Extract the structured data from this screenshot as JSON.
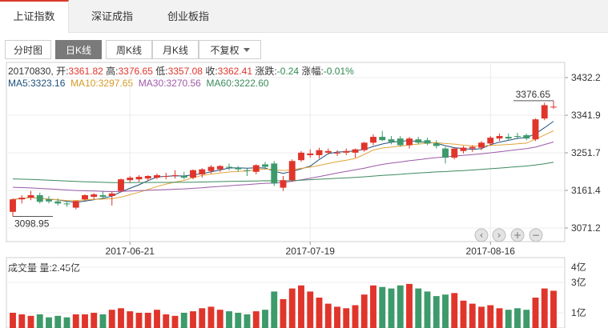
{
  "market_tabs": [
    {
      "label": "上证指数",
      "active": true
    },
    {
      "label": "深证成指",
      "active": false
    },
    {
      "label": "创业板指",
      "active": false
    }
  ],
  "kline_tabs": [
    {
      "label": "分时图",
      "active": false
    },
    {
      "label": "日K线",
      "active": true
    },
    {
      "label": "周K线",
      "active": false
    },
    {
      "label": "月K线",
      "active": false
    },
    {
      "label": "不复权",
      "active": false,
      "dropdown": true
    }
  ],
  "quote": {
    "date": "20170830",
    "open_label": "开:",
    "open": "3361.82",
    "high_label": "高:",
    "high": "3376.65",
    "low_label": "低:",
    "low": "3357.08",
    "close_label": "收:",
    "close": "3362.41",
    "change_label": "涨跌:",
    "change": "-0.24",
    "pct_label": "涨幅:",
    "pct": "-0.01%"
  },
  "ma": {
    "ma5": "MA5:3323.16",
    "ma10": "MA10:3297.65",
    "ma30": "MA30:3270.56",
    "ma60": "MA60:3222.60"
  },
  "volume": {
    "label": "成交量",
    "value_label": "量:2.45亿"
  },
  "colors": {
    "up": "#e0352b",
    "down": "#3d9a6a",
    "ma5": "#1d4f7c",
    "ma10": "#e0a43a",
    "ma30": "#9b5aa8",
    "ma60": "#3c8a5c"
  },
  "chart_data": {
    "type": "candlestick",
    "y_ticks": [
      "3432.2",
      "3341.9",
      "3251.7",
      "3161.4",
      "3071.2"
    ],
    "ylim": [
      3071.2,
      3432.2
    ],
    "x_ticks": [
      "2017-06-21",
      "2017-07-19",
      "2017-08-16"
    ],
    "annotations": {
      "max": "3376.65",
      "min": "3098.95"
    },
    "volume_ticks": [
      "4亿",
      "3亿",
      "1亿"
    ],
    "volume_ylim": [
      0,
      4
    ],
    "candles": [
      {
        "o": 3110,
        "h": 3142,
        "l": 3099,
        "c": 3140
      },
      {
        "o": 3140,
        "h": 3150,
        "l": 3130,
        "c": 3144
      },
      {
        "o": 3144,
        "h": 3160,
        "l": 3138,
        "c": 3150
      },
      {
        "o": 3150,
        "h": 3156,
        "l": 3130,
        "c": 3134
      },
      {
        "o": 3140,
        "h": 3148,
        "l": 3130,
        "c": 3135
      },
      {
        "o": 3135,
        "h": 3142,
        "l": 3125,
        "c": 3130
      },
      {
        "o": 3130,
        "h": 3136,
        "l": 3122,
        "c": 3128
      },
      {
        "o": 3120,
        "h": 3137,
        "l": 3116,
        "c": 3136
      },
      {
        "o": 3140,
        "h": 3152,
        "l": 3136,
        "c": 3150
      },
      {
        "o": 3146,
        "h": 3155,
        "l": 3140,
        "c": 3152
      },
      {
        "o": 3150,
        "h": 3160,
        "l": 3142,
        "c": 3146
      },
      {
        "o": 3148,
        "h": 3158,
        "l": 3125,
        "c": 3154
      },
      {
        "o": 3160,
        "h": 3190,
        "l": 3158,
        "c": 3188
      },
      {
        "o": 3186,
        "h": 3196,
        "l": 3180,
        "c": 3192
      },
      {
        "o": 3188,
        "h": 3198,
        "l": 3182,
        "c": 3194
      },
      {
        "o": 3190,
        "h": 3198,
        "l": 3184,
        "c": 3196
      },
      {
        "o": 3192,
        "h": 3202,
        "l": 3188,
        "c": 3198
      },
      {
        "o": 3194,
        "h": 3204,
        "l": 3188,
        "c": 3196
      },
      {
        "o": 3196,
        "h": 3210,
        "l": 3190,
        "c": 3198
      },
      {
        "o": 3196,
        "h": 3206,
        "l": 3188,
        "c": 3192
      },
      {
        "o": 3192,
        "h": 3212,
        "l": 3188,
        "c": 3210
      },
      {
        "o": 3200,
        "h": 3215,
        "l": 3192,
        "c": 3212
      },
      {
        "o": 3208,
        "h": 3222,
        "l": 3202,
        "c": 3218
      },
      {
        "o": 3212,
        "h": 3222,
        "l": 3206,
        "c": 3220
      },
      {
        "o": 3218,
        "h": 3226,
        "l": 3210,
        "c": 3216
      },
      {
        "o": 3216,
        "h": 3220,
        "l": 3206,
        "c": 3212
      },
      {
        "o": 3210,
        "h": 3214,
        "l": 3196,
        "c": 3208
      },
      {
        "o": 3206,
        "h": 3224,
        "l": 3200,
        "c": 3222
      },
      {
        "o": 3224,
        "h": 3230,
        "l": 3212,
        "c": 3218
      },
      {
        "o": 3226,
        "h": 3232,
        "l": 3172,
        "c": 3178
      },
      {
        "o": 3168,
        "h": 3196,
        "l": 3160,
        "c": 3186
      },
      {
        "o": 3186,
        "h": 3236,
        "l": 3182,
        "c": 3232
      },
      {
        "o": 3234,
        "h": 3256,
        "l": 3230,
        "c": 3252
      },
      {
        "o": 3246,
        "h": 3260,
        "l": 3240,
        "c": 3250
      },
      {
        "o": 3246,
        "h": 3264,
        "l": 3238,
        "c": 3258
      },
      {
        "o": 3252,
        "h": 3262,
        "l": 3248,
        "c": 3256
      },
      {
        "o": 3250,
        "h": 3258,
        "l": 3244,
        "c": 3252
      },
      {
        "o": 3252,
        "h": 3262,
        "l": 3246,
        "c": 3256
      },
      {
        "o": 3252,
        "h": 3262,
        "l": 3240,
        "c": 3260
      },
      {
        "o": 3258,
        "h": 3278,
        "l": 3254,
        "c": 3276
      },
      {
        "o": 3276,
        "h": 3296,
        "l": 3270,
        "c": 3290
      },
      {
        "o": 3290,
        "h": 3304,
        "l": 3280,
        "c": 3282
      },
      {
        "o": 3284,
        "h": 3292,
        "l": 3272,
        "c": 3278
      },
      {
        "o": 3286,
        "h": 3292,
        "l": 3266,
        "c": 3270
      },
      {
        "o": 3270,
        "h": 3290,
        "l": 3262,
        "c": 3286
      },
      {
        "o": 3284,
        "h": 3290,
        "l": 3272,
        "c": 3276
      },
      {
        "o": 3282,
        "h": 3288,
        "l": 3270,
        "c": 3274
      },
      {
        "o": 3274,
        "h": 3282,
        "l": 3262,
        "c": 3268
      },
      {
        "o": 3262,
        "h": 3266,
        "l": 3226,
        "c": 3240
      },
      {
        "o": 3240,
        "h": 3264,
        "l": 3236,
        "c": 3262
      },
      {
        "o": 3256,
        "h": 3268,
        "l": 3250,
        "c": 3264
      },
      {
        "o": 3262,
        "h": 3270,
        "l": 3254,
        "c": 3266
      },
      {
        "o": 3264,
        "h": 3280,
        "l": 3258,
        "c": 3276
      },
      {
        "o": 3274,
        "h": 3292,
        "l": 3268,
        "c": 3288
      },
      {
        "o": 3286,
        "h": 3298,
        "l": 3280,
        "c": 3292
      },
      {
        "o": 3290,
        "h": 3298,
        "l": 3282,
        "c": 3286
      },
      {
        "o": 3292,
        "h": 3300,
        "l": 3284,
        "c": 3290
      },
      {
        "o": 3294,
        "h": 3298,
        "l": 3282,
        "c": 3286
      },
      {
        "o": 3284,
        "h": 3334,
        "l": 3280,
        "c": 3332
      },
      {
        "o": 3334,
        "h": 3372,
        "l": 3330,
        "c": 3366
      },
      {
        "o": 3361.82,
        "h": 3376.65,
        "l": 3357.08,
        "c": 3362.41
      }
    ],
    "volumes": [
      1.0,
      0.9,
      0.8,
      0.9,
      0.7,
      0.8,
      0.7,
      0.9,
      0.9,
      1.0,
      0.9,
      1.2,
      1.3,
      1.1,
      1.0,
      1.0,
      1.2,
      0.9,
      0.8,
      1.0,
      1.1,
      1.3,
      1.4,
      1.2,
      1.1,
      1.0,
      0.9,
      1.1,
      1.2,
      2.4,
      1.9,
      2.6,
      2.8,
      2.4,
      2.0,
      1.6,
      1.4,
      1.3,
      1.5,
      2.2,
      2.8,
      2.7,
      2.6,
      2.8,
      2.9,
      2.6,
      2.4,
      2.1,
      2.2,
      2.3,
      1.8,
      1.6,
      1.4,
      1.5,
      1.3,
      1.2,
      1.3,
      1.2,
      2.0,
      2.6,
      2.45
    ]
  }
}
